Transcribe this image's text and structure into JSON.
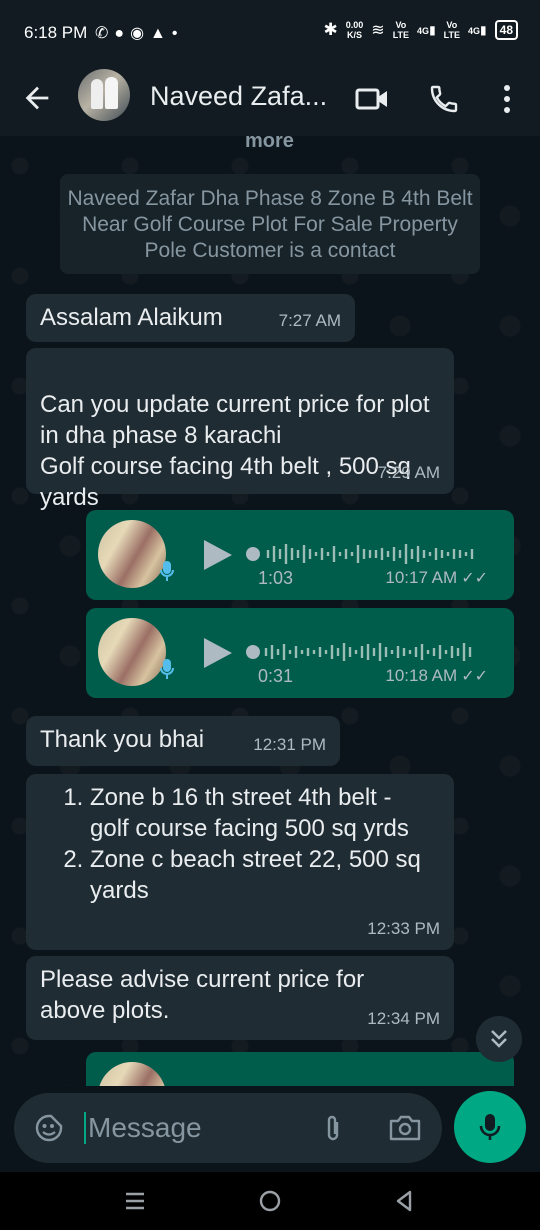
{
  "status": {
    "time": "6:18 PM",
    "speed_top": "0.00",
    "speed_bottom": "K/S",
    "net1_top": "Vo",
    "net1_bottom": "LTE",
    "net1_gen": "4G",
    "net2_top": "Vo",
    "net2_bottom": "LTE",
    "net2_gen": "4G",
    "battery": "48"
  },
  "header": {
    "title": "Naveed Zafa..."
  },
  "chat": {
    "more_label": "more",
    "notice": "Naveed Zafar Dha Phase 8 Zone B 4th Belt Near Golf Course Plot For Sale Property Pole Customer is a contact",
    "messages": [
      {
        "text": "Assalam Alaikum",
        "time": "7:27 AM"
      },
      {
        "text": "Can you update current price for plot in dha phase 8 karachi\nGolf course facing 4th belt , 500 sq yards",
        "time": "7:29 AM"
      },
      {
        "duration": "1:03",
        "time": "10:17 AM"
      },
      {
        "duration": "0:31",
        "time": "10:18 AM"
      },
      {
        "text": "Thank you bhai",
        "time": "12:31 PM"
      },
      {
        "items": [
          "Zone b 16 th street 4th belt - golf course facing 500 sq yrds",
          "Zone c beach street 22, 500 sq yards"
        ],
        "time": "12:33 PM"
      },
      {
        "text": "Please advise current price for above plots.",
        "time": "12:34 PM"
      }
    ]
  },
  "input": {
    "placeholder": "Message"
  }
}
